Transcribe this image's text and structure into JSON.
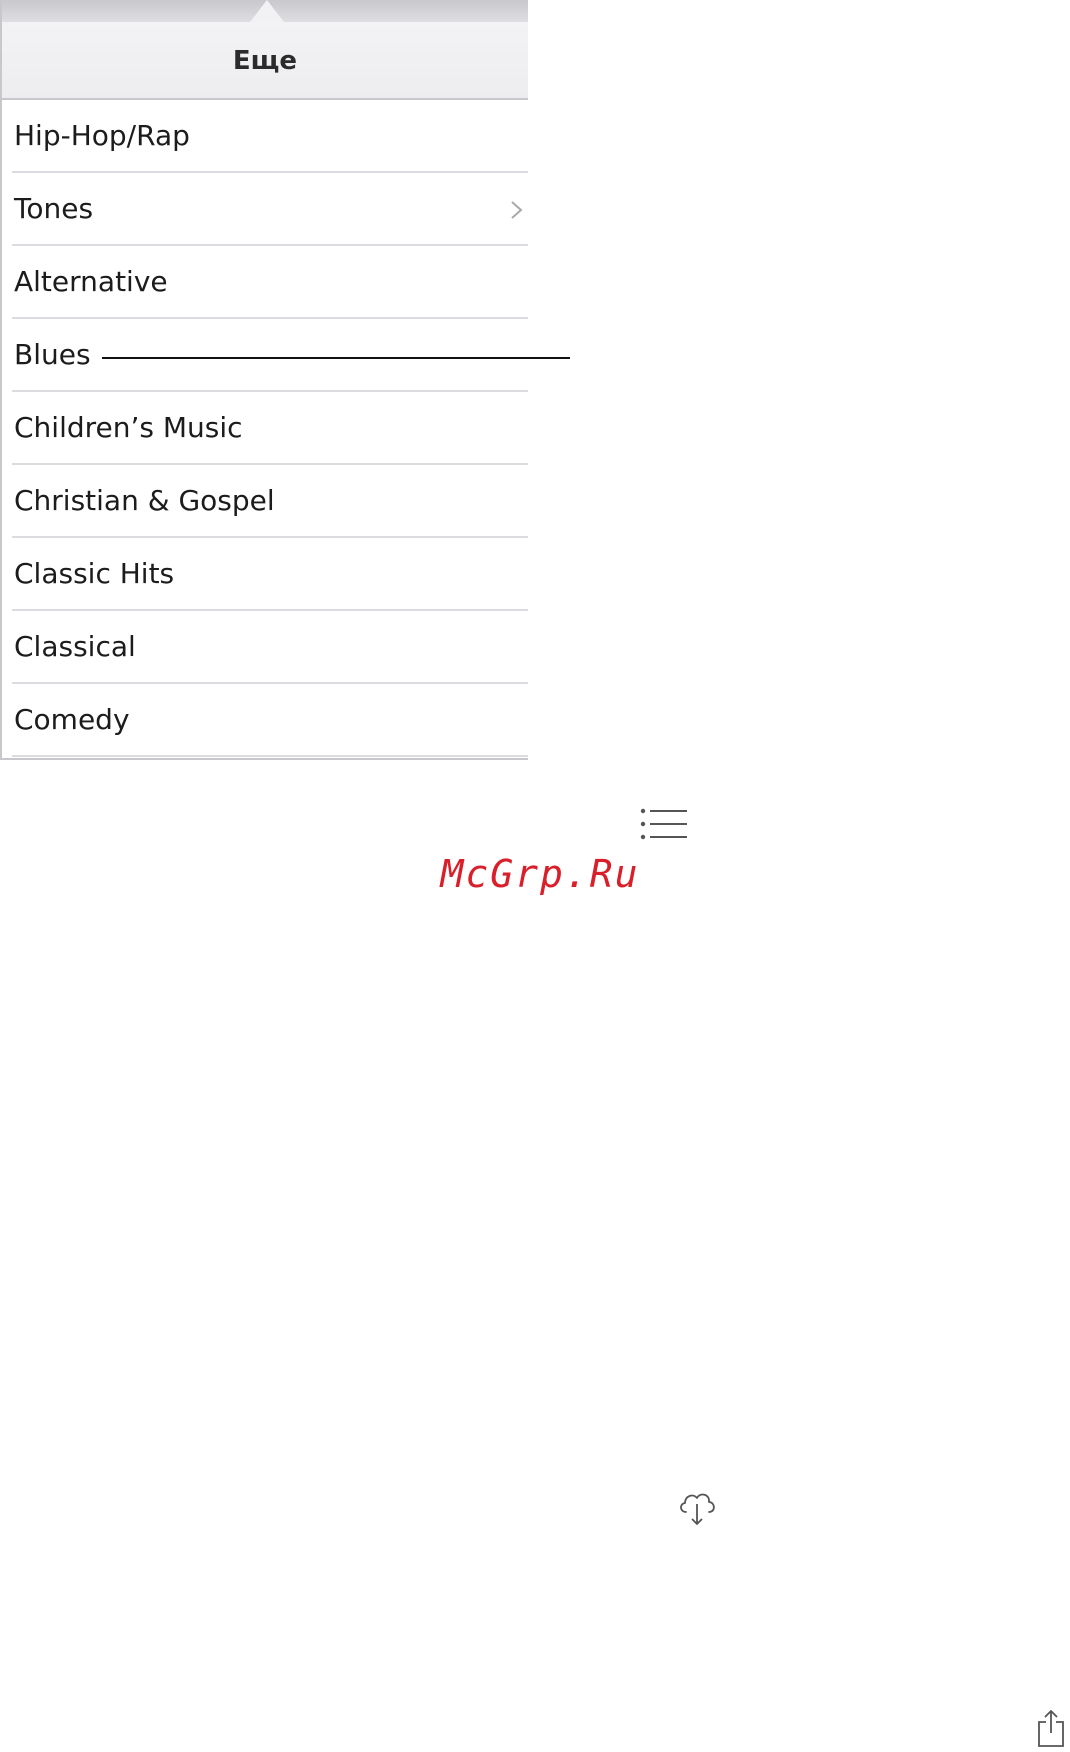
{
  "popover": {
    "title": "Еще",
    "items": [
      {
        "label": "Hip-Hop/Rap",
        "has_chevron": false
      },
      {
        "label": "Tones",
        "has_chevron": true
      },
      {
        "label": "Alternative",
        "has_chevron": false
      },
      {
        "label": "Blues",
        "has_chevron": false
      },
      {
        "label": "Children’s Music",
        "has_chevron": false
      },
      {
        "label": "Christian & Gospel",
        "has_chevron": false
      },
      {
        "label": "Classic Hits",
        "has_chevron": false
      },
      {
        "label": "Classical",
        "has_chevron": false
      },
      {
        "label": "Comedy",
        "has_chevron": false
      }
    ]
  },
  "watermark": "McGrp.Ru",
  "icons": {
    "list": "list-icon",
    "cloud_download": "cloud-download-icon",
    "share": "share-icon",
    "chevron": "chevron-right-icon"
  },
  "colors": {
    "watermark": "#d9202a",
    "text": "#1c1c1c",
    "separator": "#dcdce0",
    "icon": "#555555"
  }
}
